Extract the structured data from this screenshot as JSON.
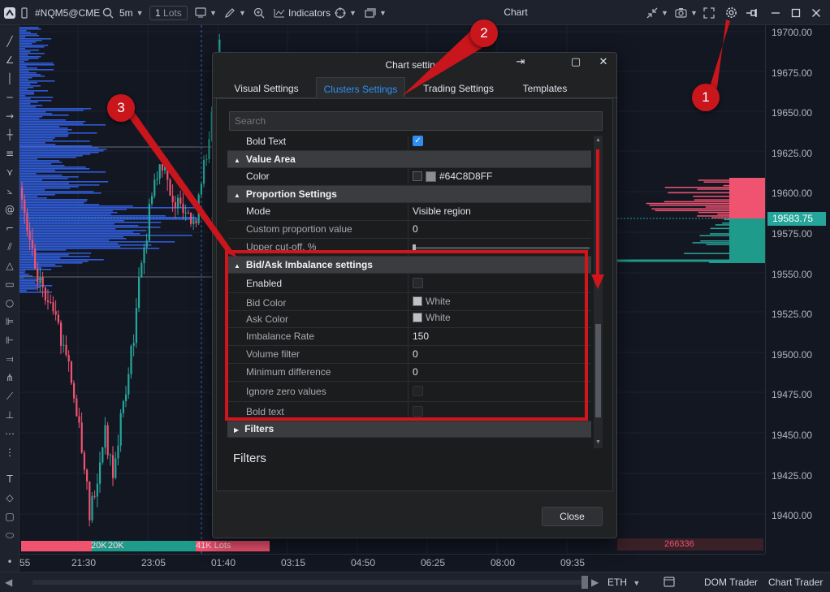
{
  "toolbar": {
    "symbol": "#NQM5@CME",
    "timeframe": "5m",
    "lots_value": "1",
    "lots_unit": "Lots",
    "indicators_label": "Indicators",
    "window_title": "Chart"
  },
  "price_axis": {
    "labels": [
      "19700.00",
      "19675.00",
      "19650.00",
      "19625.00",
      "19600.00",
      "19575.00",
      "19550.00",
      "19525.00",
      "19500.00",
      "19475.00",
      "19450.00",
      "19425.00",
      "19400.00"
    ],
    "current_price": "19583.75"
  },
  "time_axis": {
    "labels": [
      "55",
      "21:30",
      "23:05",
      "01:40",
      "03:15",
      "04:50",
      "06:25",
      "08:00",
      "09:35"
    ]
  },
  "volume_labels": {
    "left_a": "20K",
    "left_b": "20K",
    "left_c": "41K Lots",
    "right": "266336"
  },
  "bottom_bar": {
    "session": "ETH",
    "dom_trader": "DOM Trader",
    "chart_trader": "Chart Trader"
  },
  "dialog": {
    "title": "Chart settings",
    "tabs": [
      "Visual Settings",
      "Clusters Settings",
      "Trading Settings",
      "Templates"
    ],
    "active_tab": "Clusters Settings",
    "search_placeholder": "Search",
    "rows": {
      "bold_text": "Bold Text",
      "value_area": "Value Area",
      "color": "Color",
      "color_value": "#64C8D8FF",
      "proportion_settings": "Proportion Settings",
      "mode": "Mode",
      "mode_value": "Visible region",
      "custom_proportion": "Custom proportion value",
      "custom_proportion_value": "0",
      "upper_cutoff": "Upper cut-off, %",
      "bid_ask": "Bid/Ask Imbalance settings",
      "enabled": "Enabled",
      "bid_color": "Bid Color",
      "bid_color_value": "White",
      "ask_color": "Ask Color",
      "ask_color_value": "White",
      "imbalance_rate": "Imbalance Rate",
      "imbalance_rate_value": "150",
      "volume_filter": "Volume filter",
      "volume_filter_value": "0",
      "minimum_difference": "Minimum difference",
      "minimum_difference_value": "0",
      "ignore_zero": "Ignore zero values",
      "bold_text_2": "Bold text",
      "filters": "Filters"
    },
    "filters_heading": "Filters",
    "close_label": "Close"
  },
  "annotations": [
    "1",
    "2",
    "3"
  ],
  "colors": {
    "bull": "#26a69a",
    "bear": "#ef5370",
    "profile": "#2f5bd6",
    "highlight": "#d0161c",
    "accent": "#2f8ef0"
  }
}
